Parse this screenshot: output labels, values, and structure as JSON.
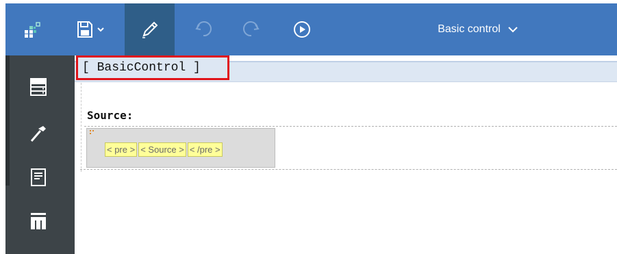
{
  "toolbar": {
    "title": "Basic control",
    "icons": [
      "apps-logo-icon",
      "save-icon",
      "chevron-down-icon",
      "edit-pencil-icon",
      "undo-icon",
      "redo-icon",
      "run-icon"
    ]
  },
  "sidebar": {
    "icons": [
      "data-icon",
      "toolbox-icon",
      "page-structure-icon",
      "table-icon"
    ]
  },
  "canvas": {
    "header_label": "[ BasicControl ]",
    "source_label": "Source:",
    "tags": [
      "< pre >",
      "< Source >",
      "< /pre >"
    ]
  },
  "colors": {
    "toolbar": "#4178be",
    "toolbar_active": "#2f5e88",
    "sidebar": "#3d4448",
    "highlight": "#e0141a",
    "tag_bg": "#ffff99"
  }
}
